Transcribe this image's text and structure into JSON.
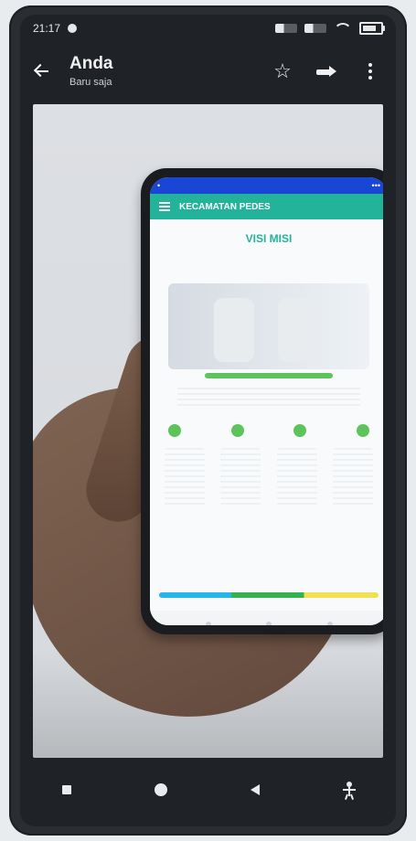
{
  "status": {
    "time": "21:17"
  },
  "appbar": {
    "title": "Anda",
    "subtitle": "Baru saja"
  },
  "photo": {
    "inner_app_title": "KECAMATAN PEDES",
    "inner_heading": "VISI MISI"
  },
  "icons": {
    "back": "back-arrow-icon",
    "star": "star-icon",
    "share": "share-icon",
    "more": "more-vertical-icon",
    "nav_recent": "square-icon",
    "nav_home": "circle-icon",
    "nav_back": "triangle-back-icon",
    "accessibility": "accessibility-icon"
  },
  "colors": {
    "frame": "#2a2d31",
    "accent_teal": "#23b39b",
    "accent_blue": "#1a46d6",
    "accent_green": "#5dc45c"
  }
}
